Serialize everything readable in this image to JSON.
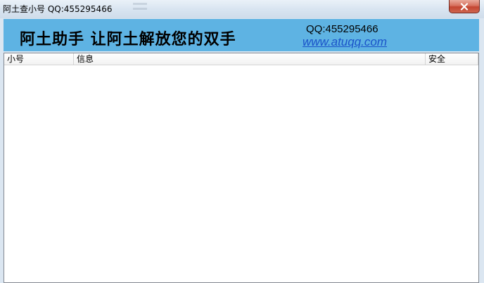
{
  "window": {
    "title": "阿土查小号 QQ:455295466",
    "close_icon": "close-icon"
  },
  "banner": {
    "slogan": "阿土助手  让阿土解放您的双手",
    "qq": "QQ:455295466",
    "url": "www.atuqq.com",
    "background": "#5eb3e3",
    "url_color": "#1a53c9"
  },
  "list": {
    "columns": [
      "小号",
      "信息",
      "安全"
    ],
    "rows": []
  },
  "colors": {
    "close_button": "#c9493a",
    "frame": "#dbe6f1"
  }
}
